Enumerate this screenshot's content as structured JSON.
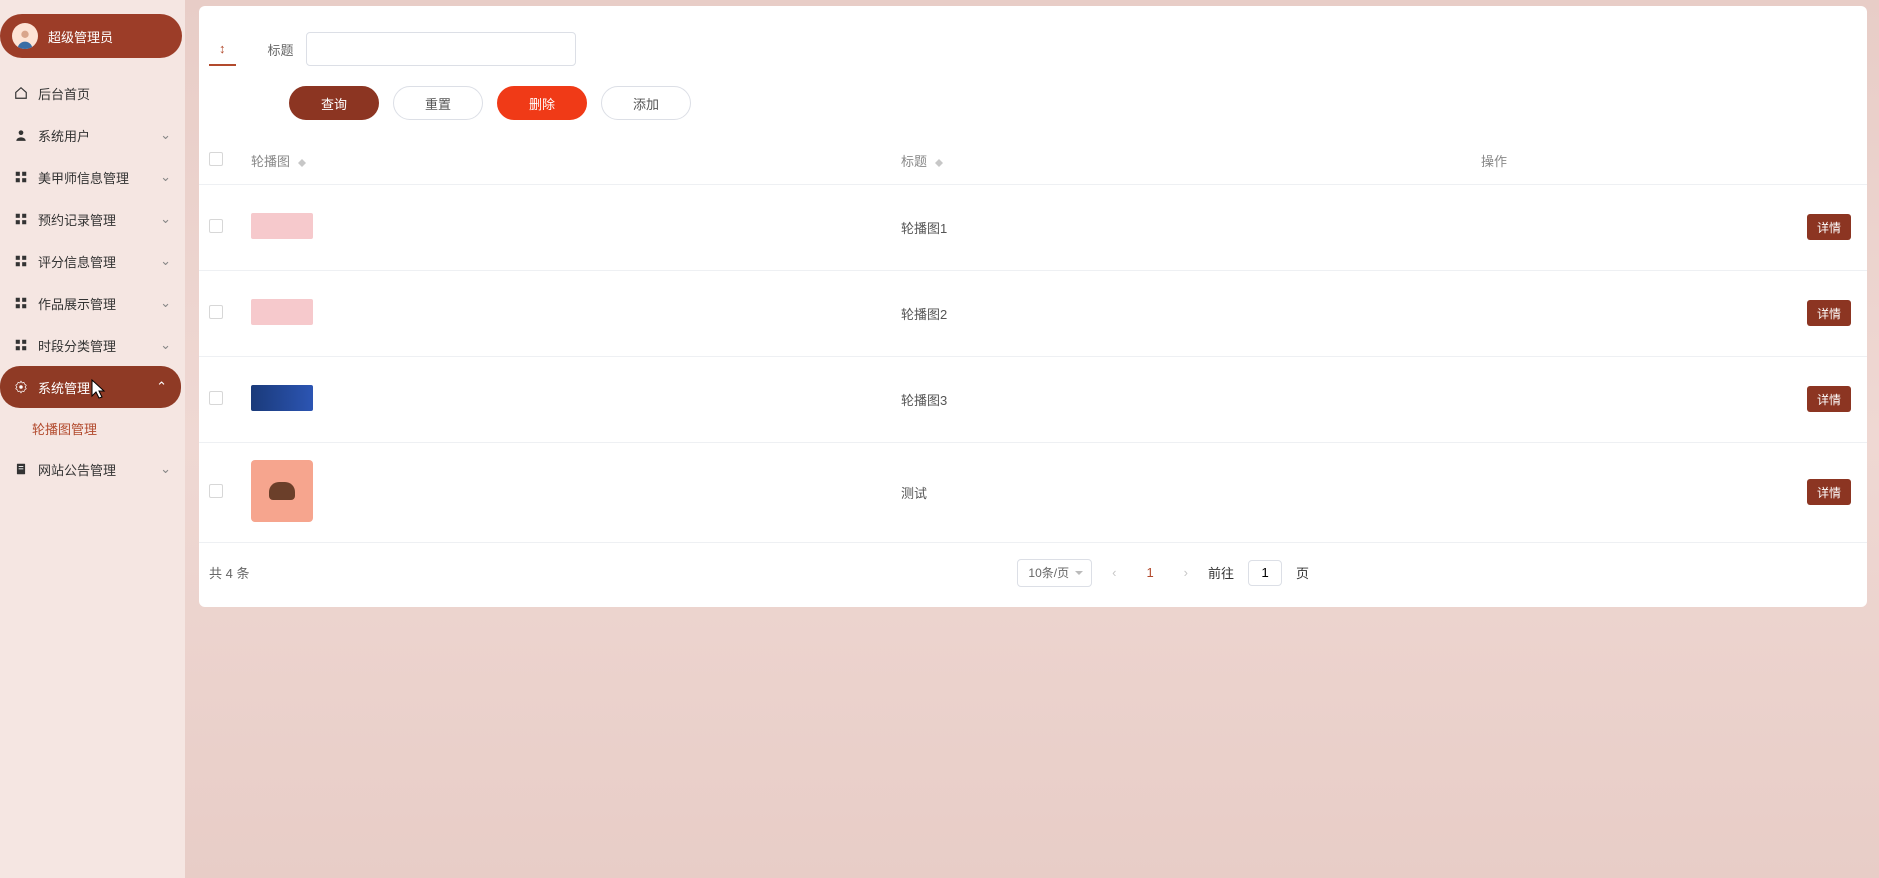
{
  "user": {
    "role": "超级管理员"
  },
  "sidebar": {
    "items": [
      {
        "label": "后台首页"
      },
      {
        "label": "系统用户"
      },
      {
        "label": "美甲师信息管理"
      },
      {
        "label": "预约记录管理"
      },
      {
        "label": "评分信息管理"
      },
      {
        "label": "作品展示管理"
      },
      {
        "label": "时段分类管理"
      },
      {
        "label": "系统管理"
      },
      {
        "label": "网站公告管理"
      }
    ],
    "sub": {
      "carousel_label": "轮播图管理"
    }
  },
  "filter": {
    "tab_glyph": "↕",
    "label": "标题",
    "value": ""
  },
  "actions": {
    "query": "查询",
    "reset": "重置",
    "delete": "删除",
    "add": "添加"
  },
  "table": {
    "headers": {
      "image": "轮播图",
      "title": "标题",
      "op": "操作"
    },
    "rows": [
      {
        "title": "轮播图1",
        "thumb": "pink1"
      },
      {
        "title": "轮播图2",
        "thumb": "pink2"
      },
      {
        "title": "轮播图3",
        "thumb": "blue"
      },
      {
        "title": "测试",
        "thumb": "square"
      }
    ],
    "detail_label": "详情"
  },
  "pager": {
    "total_text": "共 4 条",
    "per_page": "10条/页",
    "current": "1",
    "goto_prefix": "前往",
    "goto_value": "1",
    "goto_suffix": "页"
  }
}
